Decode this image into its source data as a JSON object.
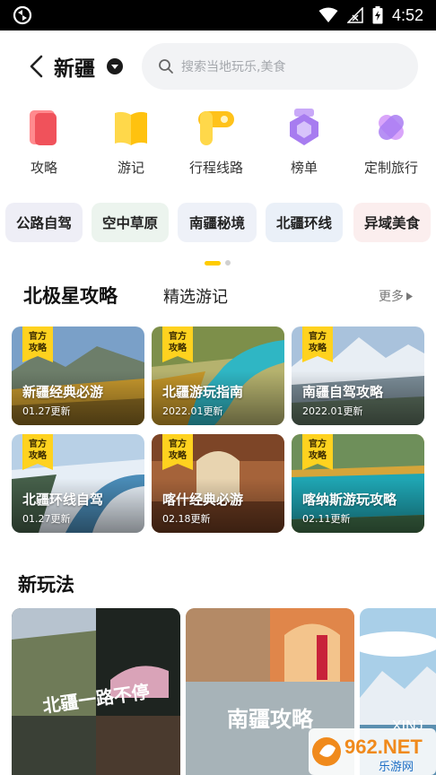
{
  "status_bar": {
    "time": "4:52"
  },
  "header": {
    "city": "新疆",
    "search_placeholder": "搜索当地玩乐,美食"
  },
  "categories": [
    {
      "label": "攻略",
      "icon": "guide-book-icon",
      "color": "#f0525b"
    },
    {
      "label": "游记",
      "icon": "travel-notes-icon",
      "color": "#ffcc1a"
    },
    {
      "label": "行程线路",
      "icon": "route-icon",
      "color": "#ffc21a"
    },
    {
      "label": "榜单",
      "icon": "ranking-icon",
      "color": "#a77cf0"
    },
    {
      "label": "定制旅行",
      "icon": "custom-trip-icon",
      "color": "#c07cf5"
    }
  ],
  "chips": [
    {
      "label": "公路自驾",
      "bg": "#eeeef6"
    },
    {
      "label": "空中草原",
      "bg": "#ecf4ee"
    },
    {
      "label": "南疆秘境",
      "bg": "#eef1f8"
    },
    {
      "label": "北疆环线",
      "bg": "#eaf0f8"
    },
    {
      "label": "异域美食",
      "bg": "#fbeeee"
    }
  ],
  "tabs": {
    "active": "北极星攻略",
    "inactive": "精选游记",
    "more": "更多"
  },
  "badge_text": [
    "官方",
    "攻略"
  ],
  "guide_cards": [
    {
      "title": "新疆经典必游",
      "date": "01.27更新"
    },
    {
      "title": "北疆游玩指南",
      "date": "2022.01更新"
    },
    {
      "title": "南疆自驾攻略",
      "date": "2022.01更新"
    },
    {
      "title": "北疆环线自驾",
      "date": "01.27更新"
    },
    {
      "title": "喀什经典必游",
      "date": "02.18更新"
    },
    {
      "title": "喀纳斯游玩攻略",
      "date": "02.11更新"
    }
  ],
  "new_play": {
    "title": "新玩法",
    "photos": [
      {
        "caption": "北疆一路不停"
      },
      {
        "caption": "南疆攻略"
      },
      {
        "caption": "XINJ"
      }
    ]
  },
  "watermark": {
    "main": "962.NET",
    "sub": "乐游网"
  },
  "colors": {
    "accent": "#ffcc00",
    "badge": "#ffd21f"
  }
}
